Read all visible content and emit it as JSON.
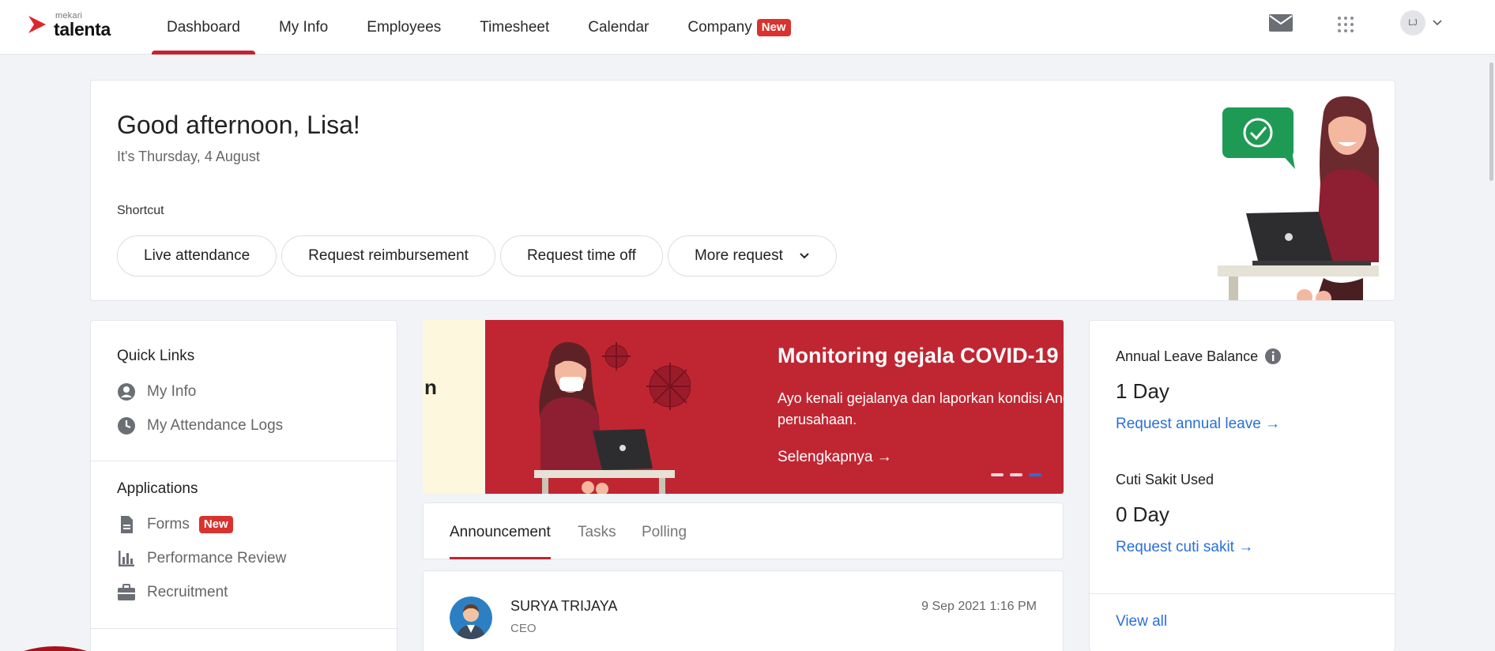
{
  "brand": {
    "small": "mekari",
    "name": "talenta"
  },
  "nav": {
    "items": [
      {
        "label": "Dashboard",
        "active": true
      },
      {
        "label": "My Info"
      },
      {
        "label": "Employees"
      },
      {
        "label": "Timesheet"
      },
      {
        "label": "Calendar"
      },
      {
        "label": "Company",
        "badge": "New"
      }
    ],
    "user_initials": "LJ"
  },
  "greeting": {
    "title": "Good afternoon, Lisa!",
    "date": "It's Thursday, 4 August",
    "shortcut_label": "Shortcut",
    "shortcuts": [
      "Live attendance",
      "Request reimbursement",
      "Request time off",
      "More request"
    ]
  },
  "quick_links": {
    "title": "Quick Links",
    "items": [
      "My Info",
      "My Attendance Logs"
    ]
  },
  "applications": {
    "title": "Applications",
    "items": [
      {
        "label": "Forms",
        "badge": "New"
      },
      {
        "label": "Performance Review"
      },
      {
        "label": "Recruitment"
      }
    ]
  },
  "banner": {
    "left_fragment": "n",
    "title": "Monitoring gejala COVID-19",
    "desc_line1": "Ayo kenali gejalanya dan laporkan kondisi And",
    "desc_line2": "perusahaan.",
    "cta": "Selengkapnya →",
    "slides": 3,
    "active_slide": 3
  },
  "feed_tabs": {
    "items": [
      "Announcement",
      "Tasks",
      "Polling"
    ],
    "active": "Announcement"
  },
  "post": {
    "name": "SURYA TRIJAYA",
    "role": "CEO",
    "time": "9 Sep 2021 1:16 PM"
  },
  "leave": {
    "annual_label": "Annual Leave Balance",
    "annual_value": "1 Day",
    "annual_link": "Request annual leave →",
    "sick_label": "Cuti Sakit Used",
    "sick_value": "0 Day",
    "sick_link": "Request cuti sakit →",
    "view_all": "View all"
  },
  "colors": {
    "accent": "#c8202f",
    "link": "#2a6fdb",
    "banner": "#c02632",
    "badge": "#d9332f"
  }
}
